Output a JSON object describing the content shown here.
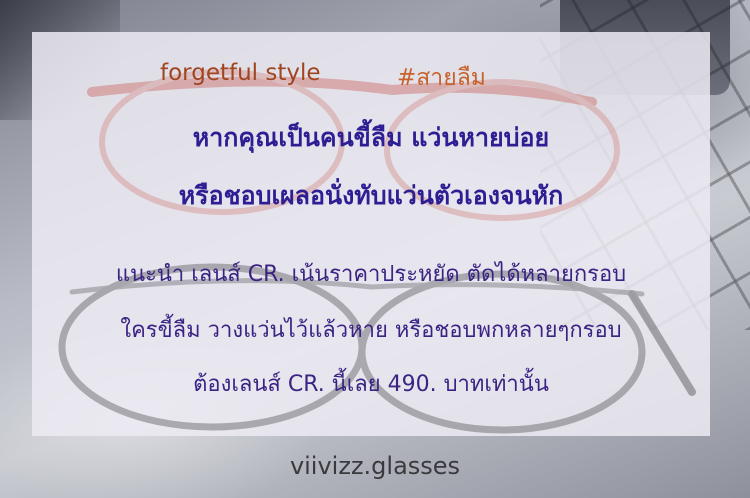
{
  "tagline": {
    "style": "forgetful style",
    "hashtag": "#สายลืม"
  },
  "headline": [
    "หากคุณเป็นคนขี้ลืม แว่นหายบ่อย",
    "หรือชอบเผลอนั่งทับแว่นตัวเองจนหัก"
  ],
  "body": [
    "แนะนำ เลนส์ CR. เน้นราคาประหยัด ตัดได้หลายกรอบ",
    "ใครขี้ลืม วางแว่นไว้แล้วหาย หรือชอบพกหลายๆกรอบ",
    "ต้องเลนส์ CR. นี้เลย 490. บาทเท่านั้น"
  ],
  "footer": "viivizz.glasses",
  "colors": {
    "tagline": "#a0451f",
    "hashtag": "#c8622a",
    "headline": "#2e1e93",
    "body": "#3b2384",
    "footer": "#3a3a3e"
  }
}
